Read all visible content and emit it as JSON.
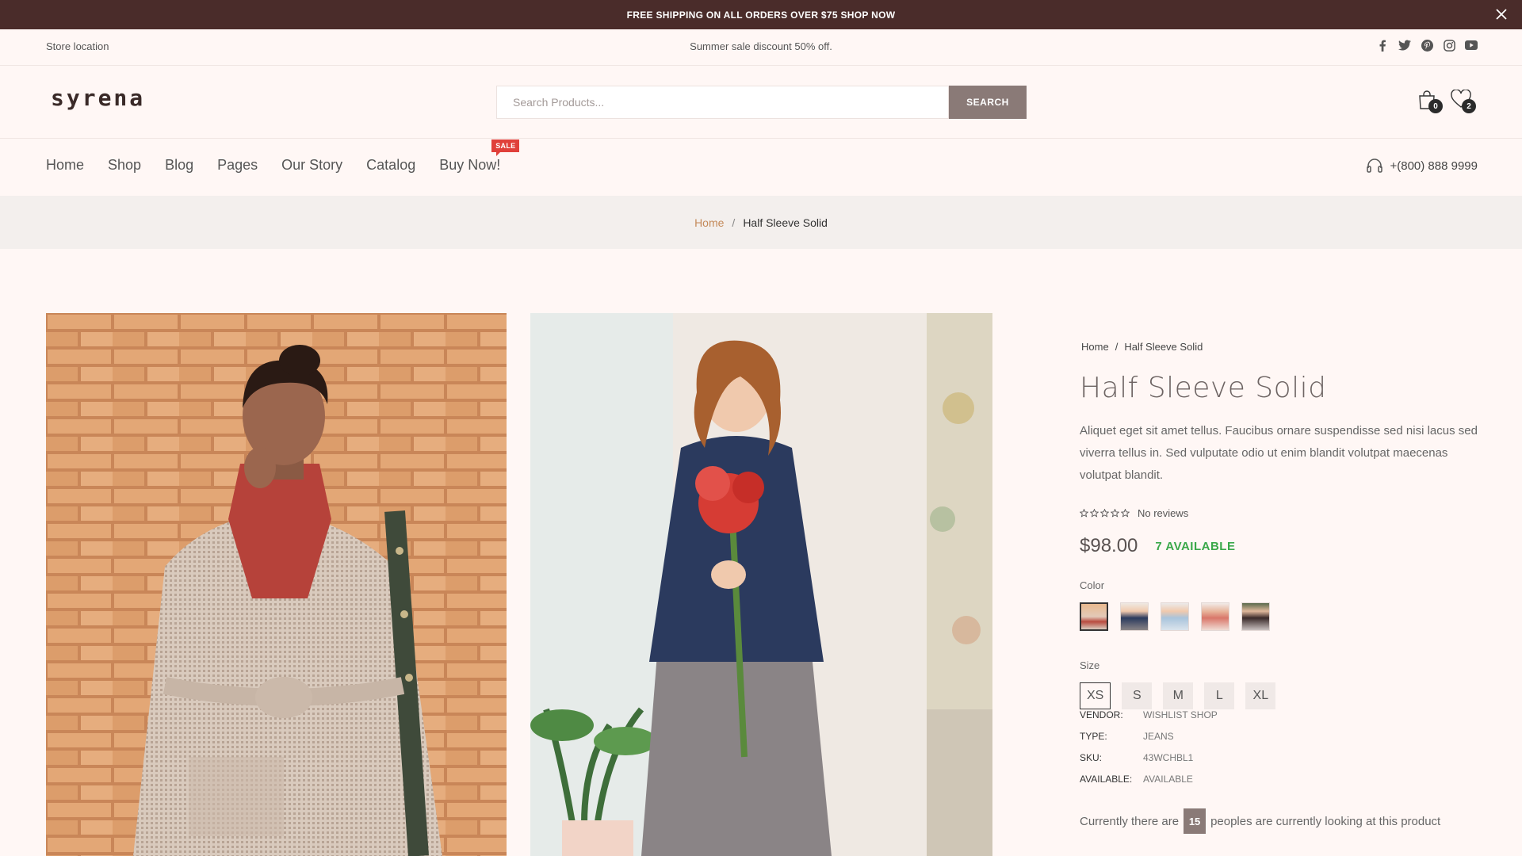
{
  "announcement": {
    "text": "FREE SHIPPING ON ALL ORDERS OVER $75 SHOP NOW",
    "close_icon": "close-icon"
  },
  "topstrip": {
    "store_location": "Store location",
    "promo": "Summer sale discount 50% off.",
    "social": [
      "facebook-icon",
      "twitter-icon",
      "pinterest-icon",
      "instagram-icon",
      "youtube-icon"
    ]
  },
  "header": {
    "logo": "syrena",
    "search_placeholder": "Search Products...",
    "search_button": "SEARCH",
    "cart_count": "0",
    "wishlist_count": "2"
  },
  "nav": {
    "items": [
      "Home",
      "Shop",
      "Blog",
      "Pages",
      "Our Story",
      "Catalog",
      "Buy Now!"
    ],
    "sale_badge": "SALE",
    "phone": "+(800) 888 9999"
  },
  "breadcrumb": {
    "home": "Home",
    "separator": "/",
    "current": "Half Sleeve Solid"
  },
  "product": {
    "breadcrumb_home": "Home",
    "breadcrumb_sep": "/",
    "breadcrumb_current": "Half Sleeve Solid",
    "title": "Half Sleeve Solid",
    "description": "Aliquet eget sit amet tellus. Faucibus ornare suspendisse sed nisi lacus sed viverra tellus in. Sed vulputate odio ut enim blandit volutpat maecenas volutpat blandit.",
    "rating_stars": 0,
    "reviews": "No reviews",
    "price": "$98.00",
    "availability": "7 AVAILABLE",
    "color_label": "Color",
    "colors": [
      "beige",
      "navy",
      "light-blue",
      "coral",
      "dark"
    ],
    "size_label": "Size",
    "sizes": [
      "XS",
      "S",
      "M",
      "L",
      "XL"
    ],
    "selected_size": "XS",
    "meta": {
      "vendor_key": "VENDOR:",
      "vendor": "WISHLIST SHOP",
      "type_key": "TYPE:",
      "type": "JEANS",
      "sku_key": "SKU:",
      "sku": "43WCHBL1",
      "available_key": "AVAILABLE:",
      "available": "AVAILABLE"
    },
    "viewers_prefix": "Currently there are",
    "viewers_count": "15",
    "viewers_suffix": "peoples are currently looking at this product"
  },
  "colors": {
    "announce_bg": "#4a2c2a",
    "page_bg": "#fff7f5",
    "accent": "#c48a5a",
    "available": "#3aa84a",
    "sale": "#e0403a"
  }
}
